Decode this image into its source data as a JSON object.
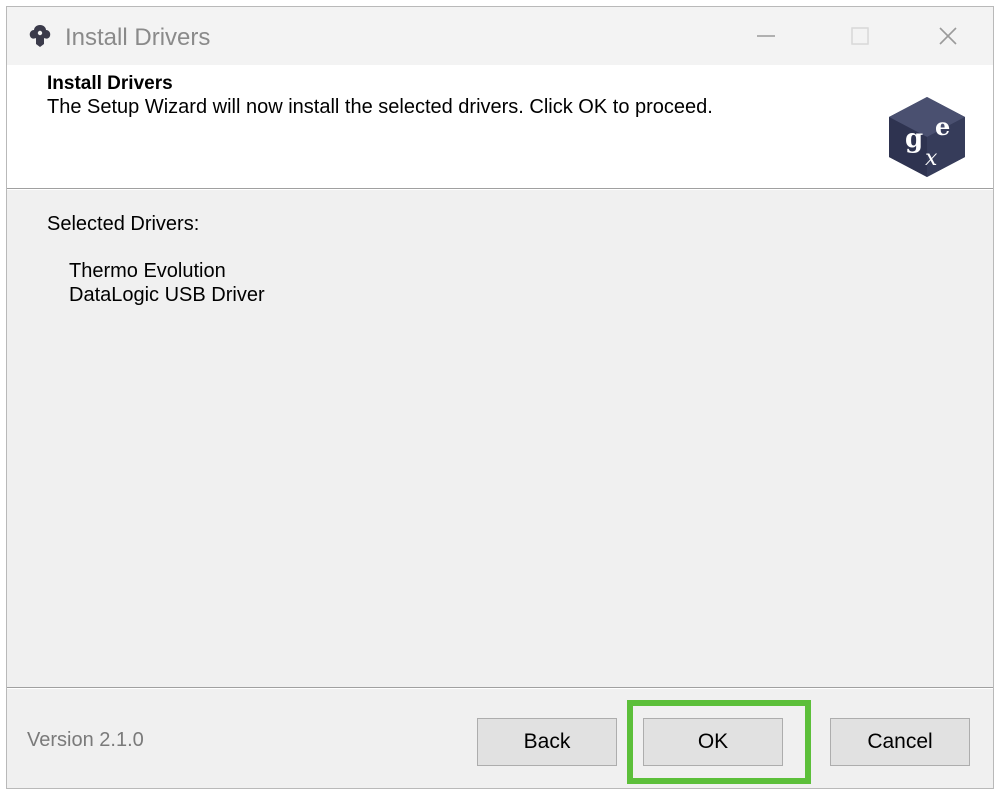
{
  "window": {
    "title": "Install Drivers",
    "controls": {
      "minimize": "minimize",
      "maximize": "maximize",
      "close": "close"
    }
  },
  "header": {
    "title": "Install Drivers",
    "description": "The Setup Wizard will now install the selected drivers. Click OK to proceed.",
    "logo_icon": "gex-cube-logo-icon"
  },
  "body": {
    "label": "Selected Drivers:",
    "drivers": [
      "Thermo Evolution",
      "DataLogic USB Driver"
    ]
  },
  "footer": {
    "version": "Version 2.1.0",
    "back_label": "Back",
    "ok_label": "OK",
    "cancel_label": "Cancel"
  },
  "colors": {
    "highlight": "#5cbf3a",
    "logo": "#3a4060"
  }
}
